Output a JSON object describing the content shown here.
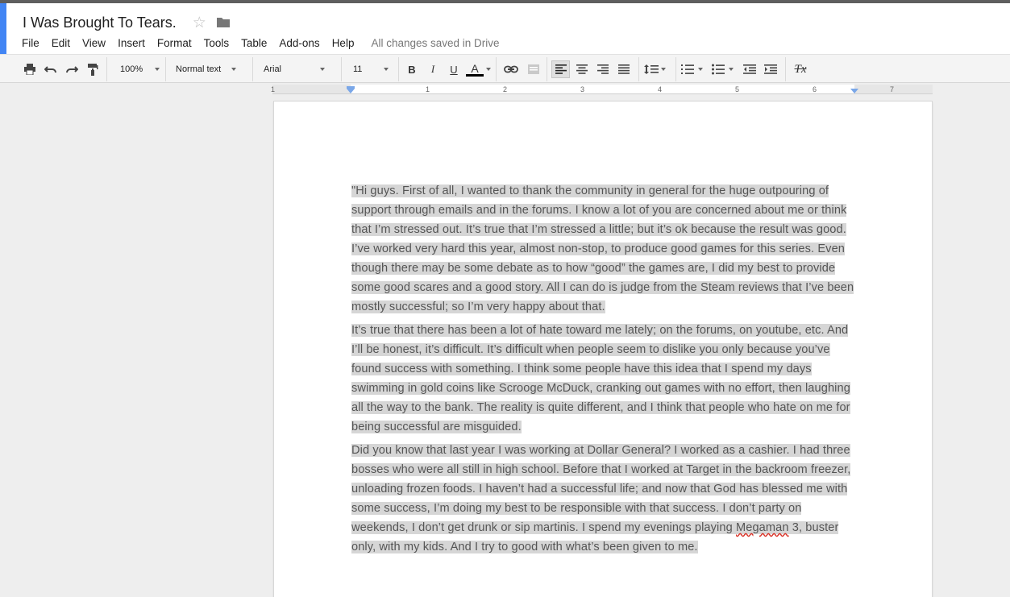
{
  "doc": {
    "title": "I Was Brought To Tears.",
    "save_status": "All changes saved in Drive"
  },
  "menu": {
    "items": [
      "File",
      "Edit",
      "View",
      "Insert",
      "Format",
      "Tools",
      "Table",
      "Add-ons",
      "Help"
    ]
  },
  "toolbar": {
    "zoom": "100%",
    "style": "Normal text",
    "font": "Arial",
    "font_size": "11",
    "bold": "B",
    "italic": "I",
    "underline": "U",
    "text_color": "A",
    "text_color_value": "#000000",
    "clear_format": "Tx",
    "active_alignment": "left"
  },
  "ruler": {
    "labels": [
      "1",
      "1",
      "2",
      "3",
      "4",
      "5",
      "6",
      "7"
    ]
  },
  "colors": {
    "brand": "#4285f4",
    "selection": "#d6d6d6",
    "spellcheck": "#d93025"
  },
  "paragraphs": [
    "\"Hi guys. First of all, I wanted to thank the community in general for the huge outpouring of support through emails and in the forums. I know a lot of you are concerned about me or think that I’m stressed out. It’s true that I’m stressed a little; but it’s ok because the result was good. I’ve worked very hard this year, almost non-stop, to produce good games for this series. Even though there may be some debate as to how “good” the games are, I did my best to provide some good scares and a good story. All I can do is judge from the Steam reviews that I’ve been mostly successful; so I’m very happy about that.",
    "It’s true that there has been a lot of hate toward me lately; on the forums, on youtube, etc. And I’ll be honest, it’s difficult. It’s difficult when people seem to dislike you only because you’ve found success with something. I think some people have this idea that I spend my days swimming in gold coins like Scrooge McDuck, cranking out games with no effort, then laughing all the way to the bank. The reality is quite different, and I think that people who hate on me for being successful are misguided.",
    {
      "before": "Did you know that last year I was working at Dollar General? I worked as a cashier. I had three bosses who were all still in high school. Before that I worked at Target in the backroom freezer, unloading frozen foods. I haven’t had a successful life; and now that God has blessed me with some success, I’m doing my best to be responsible with that success. I don’t party on weekends, I don’t get drunk or sip martinis. I spend my evenings playing ",
      "misspelled": "Megaman",
      "after": " 3, buster only, with my kids. And I try to good with what’s been given to me."
    }
  ]
}
